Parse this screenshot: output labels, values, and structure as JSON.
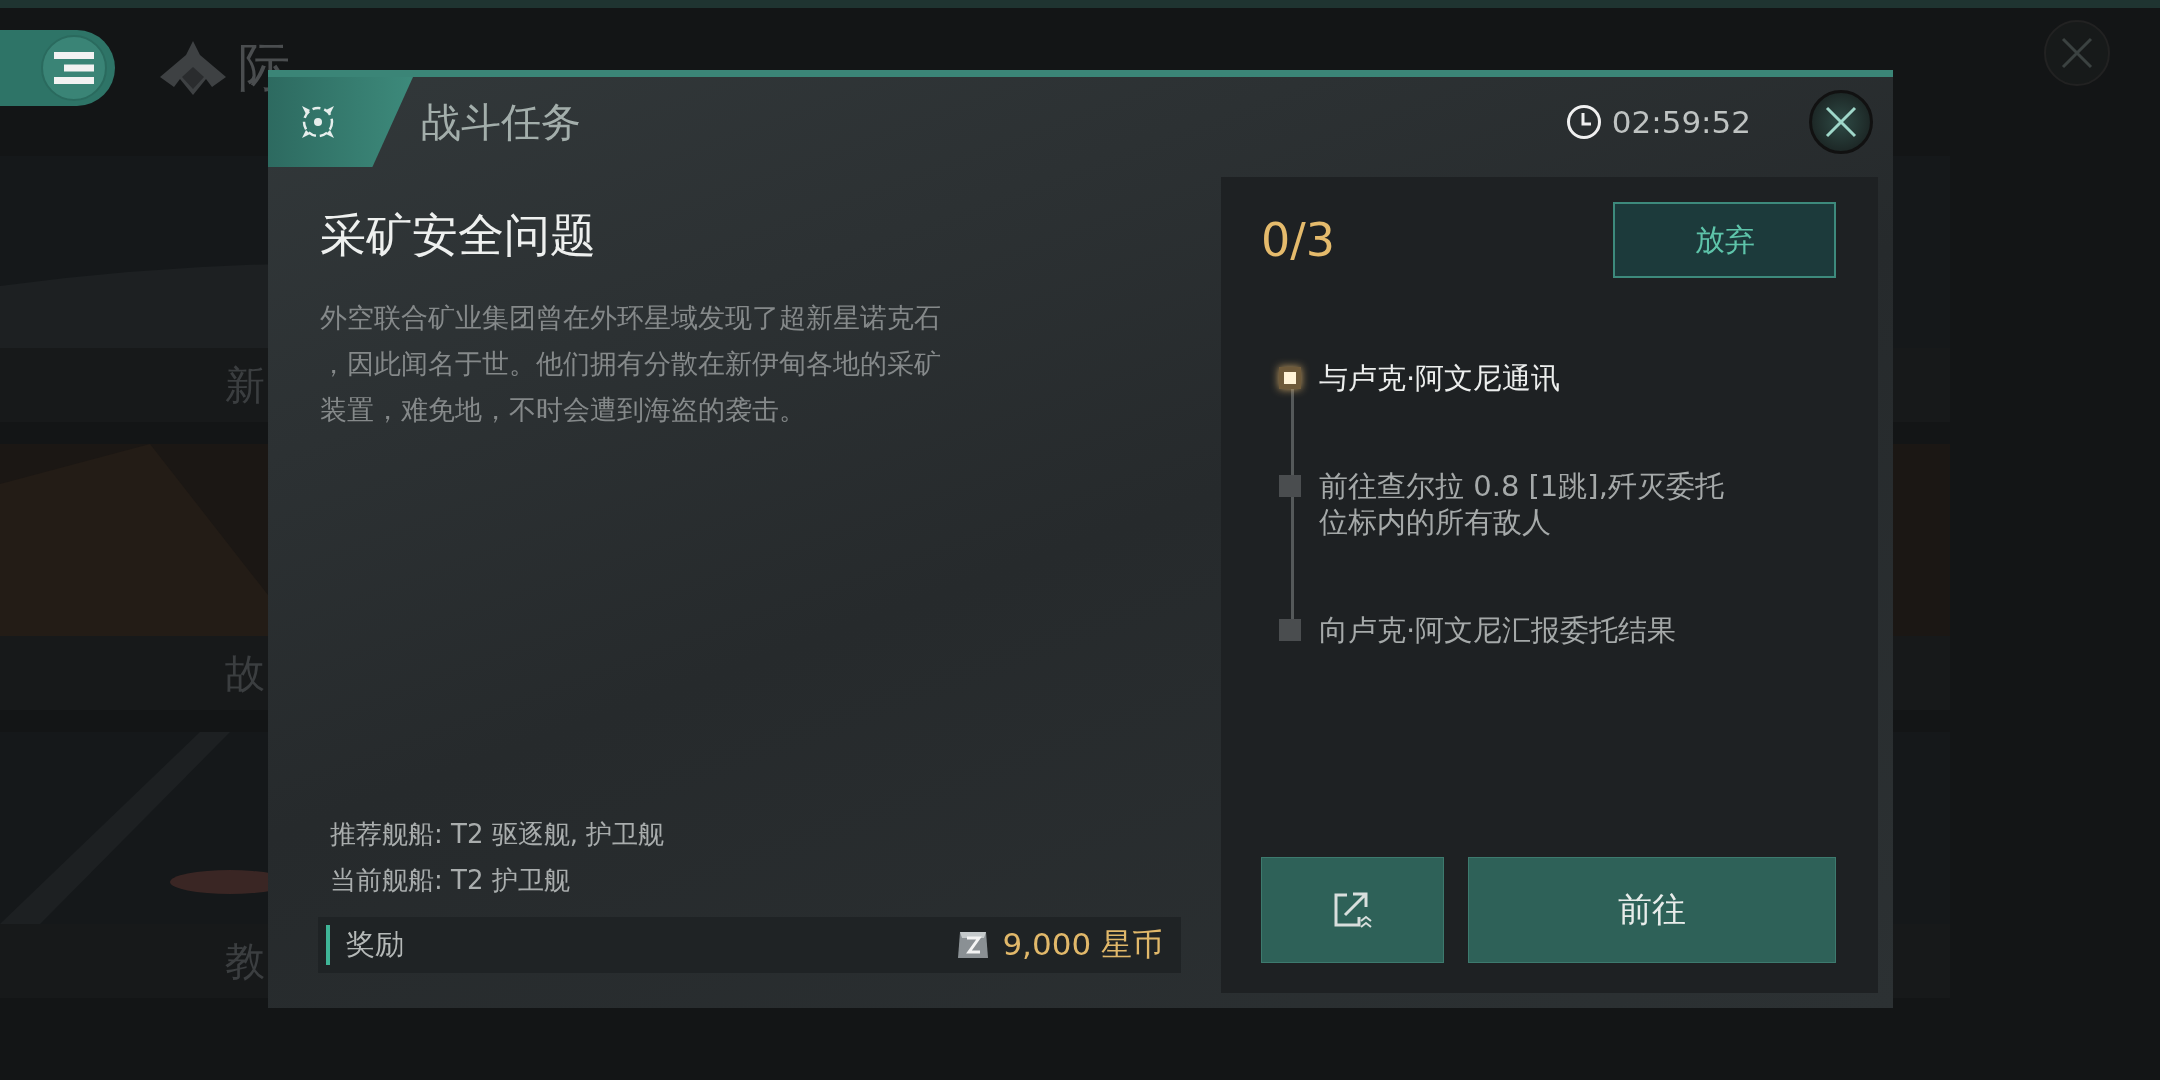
{
  "background": {
    "logo_text": "际",
    "cards": [
      {
        "label": "新"
      },
      {
        "label": "故"
      },
      {
        "label": "教"
      }
    ]
  },
  "dialog": {
    "title": "战斗任务",
    "timer": "02:59:52",
    "mission": {
      "title": "采矿安全问题",
      "description": "外空联合矿业集团曾在外环星域发现了超新星诺克石，因此闻名于世。他们拥有分散在新伊甸各地的采矿装置，难免地，不时会遭到海盗的袭击。",
      "ship_info": [
        "推荐舰船: T2 驱逐舰, 护卫舰",
        "当前舰船: T2 护卫舰"
      ],
      "reward": {
        "label": "奖励",
        "amount": "9,000 星币"
      }
    },
    "progress": "0/3",
    "abandon_button": "放弃",
    "steps": [
      {
        "text": "与卢克·阿文尼通讯",
        "active": true
      },
      {
        "text": "前往查尔拉 0.8 [1跳],歼灭委托位标内的所有敌人",
        "active": false
      },
      {
        "text": "向卢克·阿文尼汇报委托结果",
        "active": false
      }
    ],
    "go_button": "前往"
  }
}
